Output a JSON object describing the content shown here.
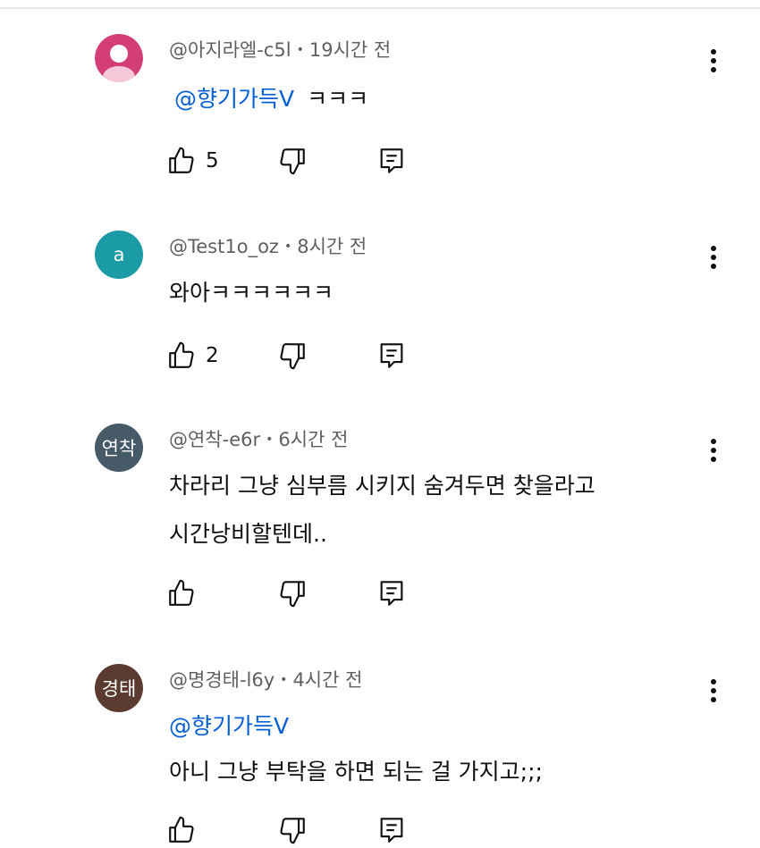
{
  "comments": [
    {
      "author": "@아지라엘-c5l",
      "time": "19시간 전",
      "avatar_text": "",
      "avatar_color": "#d33e77",
      "mention": "@향기가득V",
      "text": "ㅋㅋㅋ",
      "likes": "5"
    },
    {
      "author": "@Test1o_oz",
      "time": "8시간 전",
      "avatar_text": "a",
      "avatar_color": "#1a9ba6",
      "text": "와아ㅋㅋㅋㅋㅋㅋ",
      "likes": "2"
    },
    {
      "author": "@연착-e6r",
      "time": "6시간 전",
      "avatar_text": "연착",
      "avatar_color": "#465a67",
      "text_line1": "차라리 그냥 심부름 시키지 숨겨두면 찾을라고",
      "text_line2": "시간낭비할텐데..",
      "likes": ""
    },
    {
      "author": "@명경태-l6y",
      "time": "4시간 전",
      "avatar_text": "경태",
      "avatar_color": "#5b3a30",
      "mention": "@향기가득V",
      "text": "아니 그냥 부탁을 하면 되는 걸 가지고;;;",
      "likes": ""
    }
  ],
  "icons": {
    "like": "thumbs-up-icon",
    "dislike": "thumbs-down-icon",
    "reply": "reply-icon",
    "more": "more-vertical-icon"
  },
  "colors": {
    "mention": "#065fd4",
    "meta": "#606060"
  }
}
